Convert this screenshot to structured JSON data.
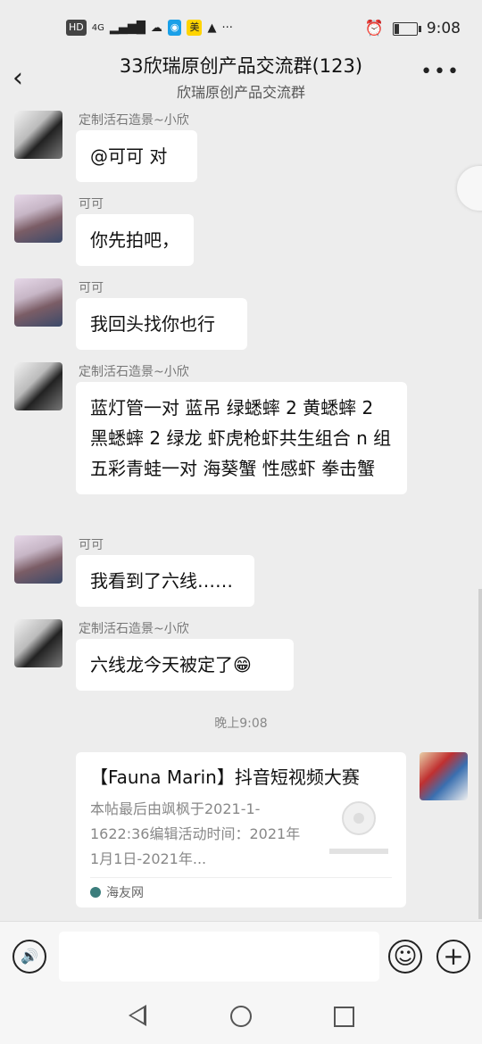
{
  "status_bar": {
    "left_labels": [
      "HD",
      "4G"
    ],
    "app_badge": "美",
    "more": "···",
    "time": "9:08",
    "battery_level": 0.2
  },
  "header": {
    "title": "33欣瑞原创产品交流群(123)",
    "subtitle": "欣瑞原创产品交流群",
    "back_glyph": "‹",
    "more_glyph": "•••"
  },
  "messages": [
    {
      "sender": "定制活石造景~小欣",
      "text": "@可可  对"
    },
    {
      "sender": "可可",
      "text": "你先拍吧，"
    },
    {
      "sender": "可可",
      "text": "我回头找你也行"
    },
    {
      "sender": "定制活石造景~小欣",
      "text": "蓝灯管一对 蓝吊 绿蟋蟀 2 黄蟋蟀 2 黑蟋蟀 2 绿龙 虾虎枪虾共生组合 n 组 五彩青蛙一对 海葵蟹 性感虾 拳击蟹"
    },
    {
      "sender": "可可",
      "text": "我看到了六线……"
    },
    {
      "sender": "定制活石造景~小欣",
      "text": "六线龙今天被定了😁"
    }
  ],
  "time_divider": "晚上9:08",
  "card": {
    "title": "【Fauna Marin】抖音短视频大赛",
    "description": "本帖最后由飒枫于2021-1-1622:36编辑活动时间：2021年1月1日-2021年...",
    "source": "海友网"
  },
  "input_bar": {
    "voice_glyph": "🔊",
    "emoji_glyph": "☺",
    "plus_glyph": "+"
  }
}
